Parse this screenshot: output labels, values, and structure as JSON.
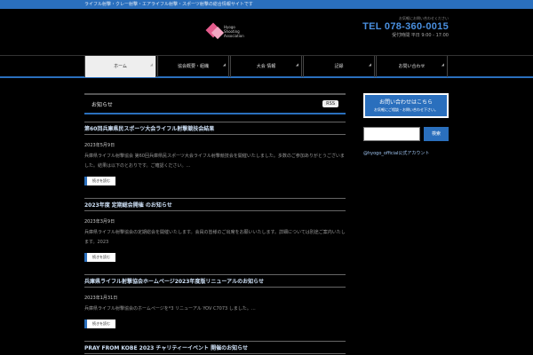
{
  "topbar": {
    "text": "ライフル射撃・クレー射撃・エアライフル射撃・スポーツ射撃の総合情報サイトです"
  },
  "logo": {
    "line1": "Hyogo",
    "line2": "Shooting",
    "line3": "Association"
  },
  "header": {
    "tel_caption": "お気軽にお問い合わせください",
    "tel": "TEL 078-360-0015",
    "hours": "受付時間 平日 9:00 - 17:00"
  },
  "nav": {
    "items": [
      {
        "label": "ホーム",
        "active": true
      },
      {
        "label": "協会概要・組織",
        "active": false
      },
      {
        "label": "大会 情報",
        "active": false
      },
      {
        "label": "記録",
        "active": false
      },
      {
        "label": "お問い合わせ",
        "active": false
      }
    ]
  },
  "main": {
    "heading": "お知らせ",
    "rss": "RSS",
    "posts": [
      {
        "title": "第60回兵庫県民スポーツ大会ライフル射撃競技会結果",
        "date": "2023年5月9日",
        "excerpt": "兵庫県ライフル射撃協会 第60回兵庫県民スポーツ大会ライフル射撃競技会を開催いたしました。多数のご参加ありがとうございました。結果は以下のとおりです。ご確認ください。…",
        "more": "続きを読む"
      },
      {
        "title": "2023年度 定期総会開催 のお知らせ",
        "date": "2023年3月9日",
        "excerpt": "兵庫県ライフル射撃協会の定期総会を開催いたします。会員の皆様のご出席をお願いいたします。詳細については別途ご案内いたします。2023",
        "more": "続きを読む"
      },
      {
        "title": "兵庫県ライフル射撃協会ホームページ2023年度版リニューアルのお知らせ",
        "date": "2023年1月31日",
        "excerpt": "兵庫県ライフル射撃協会のホームページを*3 リニューアル YOV C7073 しました。…",
        "more": "続きを読む"
      },
      {
        "title": "PRAY FROM KOBE 2023 チャリティーイベント 開催のお知らせ",
        "date": "",
        "excerpt": "",
        "more": ""
      }
    ]
  },
  "sidebar": {
    "contact_main": "お問い合わせはこちら",
    "contact_sub": "お気軽にご相談・お問い合わせ下さい。",
    "search_button": "検索",
    "search_placeholder": "",
    "link": "@hyogo_official公式アカウント"
  },
  "colors": {
    "accent": "#2a6fbd",
    "background": "#000000"
  }
}
